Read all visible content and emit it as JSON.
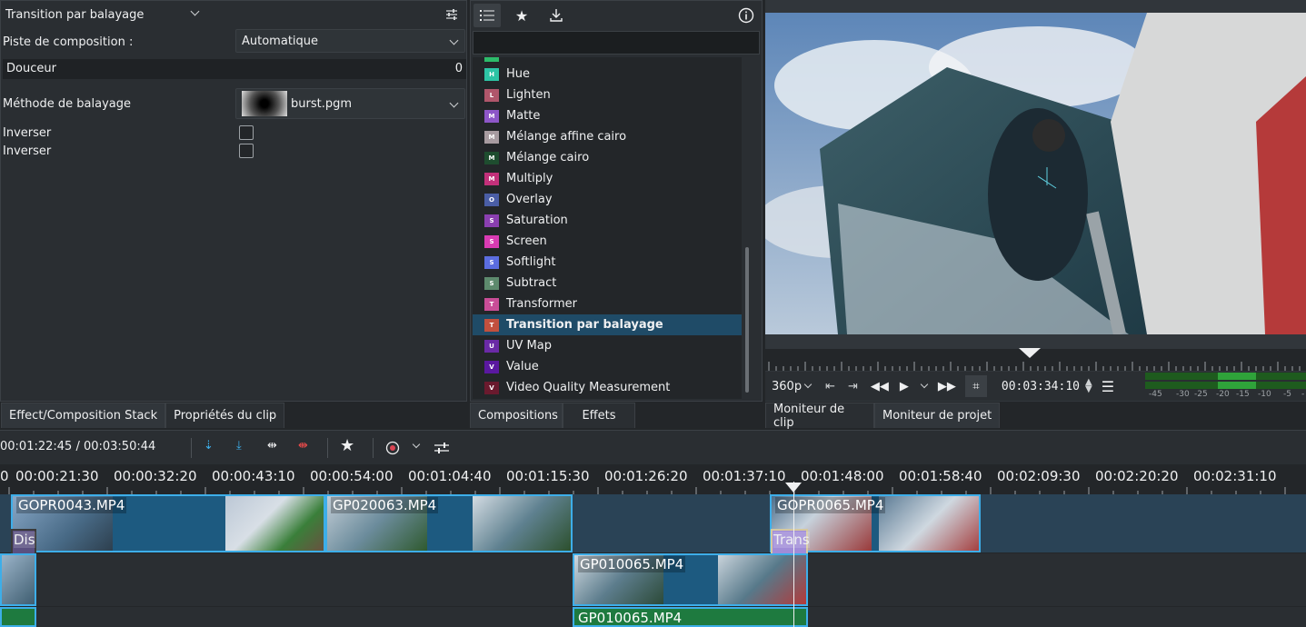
{
  "props_panel": {
    "title": "Transition par balayage",
    "track_label": "Piste de composition :",
    "track_value": "Automatique",
    "softness_label": "Douceur",
    "softness_value": "0",
    "wipe_label": "Méthode de balayage",
    "wipe_value": "burst.pgm",
    "invert1_label": "Inverser",
    "invert2_label": "Inverser"
  },
  "left_tabs": [
    "Effect/Composition Stack",
    "Propriétés du clip"
  ],
  "compositions": {
    "items": [
      {
        "label": "Hue",
        "badge": "H",
        "color": "#2dc4a5"
      },
      {
        "label": "Lighten",
        "badge": "L",
        "color": "#b0566b"
      },
      {
        "label": "Matte",
        "badge": "M",
        "color": "#8d56c7"
      },
      {
        "label": "Mélange affine cairo",
        "badge": "M",
        "color": "#a79ba0"
      },
      {
        "label": "Mélange cairo",
        "badge": "M",
        "color": "#1e4d2f"
      },
      {
        "label": "Multiply",
        "badge": "M",
        "color": "#c2307a"
      },
      {
        "label": "Overlay",
        "badge": "O",
        "color": "#4a5ea6"
      },
      {
        "label": "Saturation",
        "badge": "S",
        "color": "#8a3fb0"
      },
      {
        "label": "Screen",
        "badge": "S",
        "color": "#d93bb3"
      },
      {
        "label": "Softlight",
        "badge": "S",
        "color": "#5b6de0"
      },
      {
        "label": "Subtract",
        "badge": "S",
        "color": "#5d8a6d"
      },
      {
        "label": "Transformer",
        "badge": "T",
        "color": "#c94d97"
      },
      {
        "label": "Transition par balayage",
        "badge": "T",
        "color": "#c2503e"
      },
      {
        "label": "UV Map",
        "badge": "U",
        "color": "#6a2aa6"
      },
      {
        "label": "Value",
        "badge": "V",
        "color": "#5a18a0"
      },
      {
        "label": "Video Quality Measurement",
        "badge": "V",
        "color": "#6a1a2e"
      }
    ],
    "selected_index": 12
  },
  "mid_tabs": [
    "Compositions",
    "Effets"
  ],
  "monitor": {
    "resolution": "360p",
    "timecode": "00:03:34:10",
    "meter_labels": [
      "-45",
      "-30",
      "-25",
      "-20",
      "-15",
      "-10",
      "-5",
      "-"
    ]
  },
  "right_tabs": [
    "Moniteur de clip",
    "Moniteur de projet"
  ],
  "timeline": {
    "position": "00:01:22:45 / 00:03:50:44",
    "ticks": [
      "0",
      "00:00:21:30",
      "00:00:32:20",
      "00:00:43:10",
      "00:00:54:00",
      "00:01:04:40",
      "00:01:15:30",
      "00:01:26:20",
      "00:01:37:10",
      "00:01:48:00",
      "00:01:58:40",
      "00:02:09:30",
      "00:02:20:20",
      "00:02:31:10"
    ],
    "clips": {
      "c1": "GOPR0043.MP4",
      "c2": "GP020063.MP4",
      "c3": "GOPR0065.MP4",
      "c4": "GP010065.MP4",
      "c5": "GP010065.MP4",
      "comp1": "Dis",
      "comp2": "Trans"
    }
  }
}
